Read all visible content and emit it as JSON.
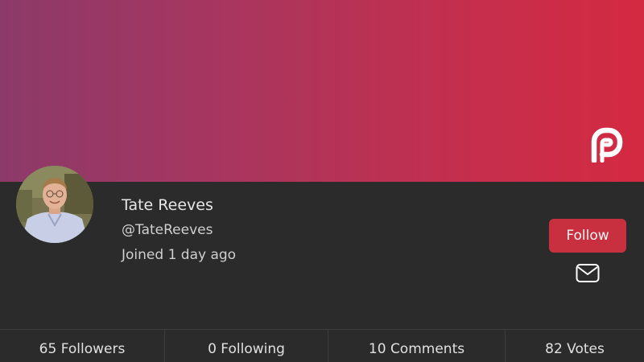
{
  "profile": {
    "name": "Tate Reeves",
    "handle": "@TateReeves",
    "joined": "Joined 1 day ago"
  },
  "actions": {
    "follow_label": "Follow",
    "message_icon": "envelope-icon"
  },
  "logo": {
    "icon": "parler-logo-icon"
  },
  "stats": {
    "followers": "65 Followers",
    "following": "0 Following",
    "comments": "10 Comments",
    "votes": "82 Votes"
  },
  "colors": {
    "banner_start": "#8c3a6a",
    "banner_end": "#d42a41",
    "follow_button": "#c8303f",
    "background": "#2b2b2b"
  }
}
